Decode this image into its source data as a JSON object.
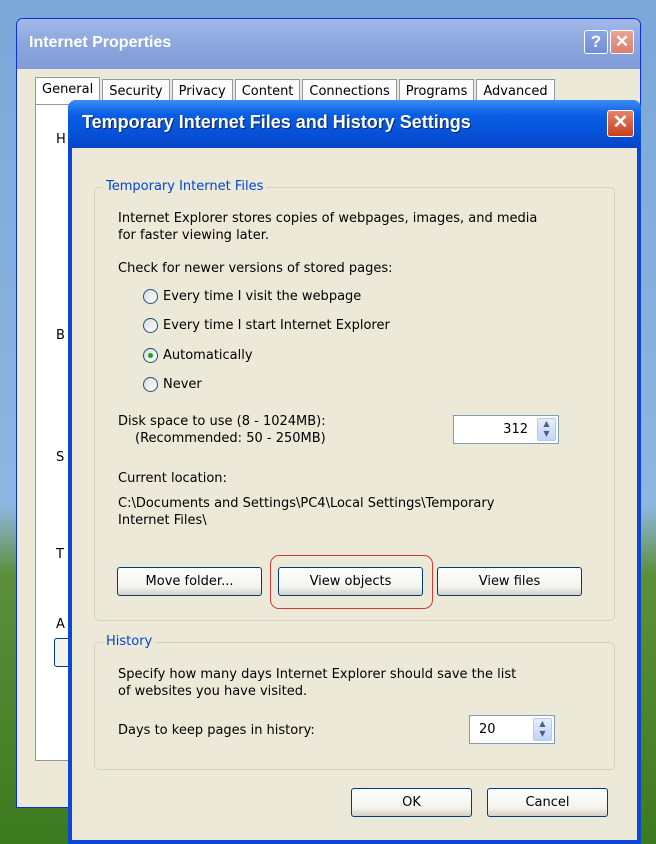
{
  "outer_window": {
    "title": "Internet Properties",
    "help_glyph": "?",
    "close_glyph": "✕",
    "tabs": [
      "General",
      "Security",
      "Privacy",
      "Content",
      "Connections",
      "Programs",
      "Advanced"
    ],
    "side_letters": [
      "H",
      "B",
      "S",
      "T",
      "A"
    ]
  },
  "dialog": {
    "title": "Temporary Internet Files and History Settings",
    "close_glyph": "✕",
    "temp_files": {
      "label": "Temporary Internet Files",
      "description_line1": "Internet Explorer stores copies of webpages, images, and media",
      "description_line2": "for faster viewing later.",
      "check_label": "Check for newer versions of stored pages:",
      "options": [
        {
          "label": "Every time I visit the webpage",
          "checked": false
        },
        {
          "label": "Every time I start Internet Explorer",
          "checked": false
        },
        {
          "label": "Automatically",
          "checked": true
        },
        {
          "label": "Never",
          "checked": false
        }
      ],
      "disk_label_line1": "Disk space to use (8 - 1024MB):",
      "disk_label_line2": "(Recommended: 50 - 250MB)",
      "disk_value": "312",
      "location_label": "Current location:",
      "location_line1": "C:\\Documents and Settings\\PC4\\Local Settings\\Temporary",
      "location_line2": "Internet Files\\",
      "buttons": {
        "move": "Move folder...",
        "view_objects": "View objects",
        "view_files": "View files"
      }
    },
    "history": {
      "label": "History",
      "description_line1": "Specify how many days Internet Explorer should save the list",
      "description_line2": "of websites you have visited.",
      "days_label": "Days to keep pages in history:",
      "days_value": "20"
    },
    "ok": "OK",
    "cancel": "Cancel"
  },
  "colors": {
    "group_label": "#0046d5",
    "highlight": "#d63b3b",
    "dialog_title": "#0651d8"
  }
}
